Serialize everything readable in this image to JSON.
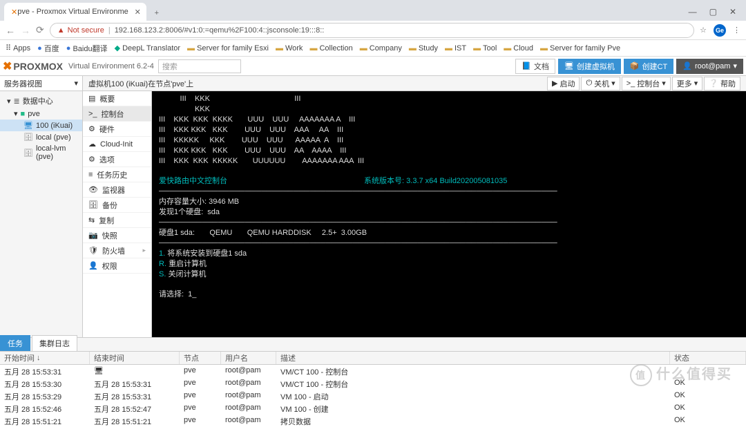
{
  "browser": {
    "tab_title": "pve - Proxmox Virtual Environme",
    "url": "192.168.123.2:8006/#v1:0:=qemu%2F100:4::jsconsole:19:::8::",
    "not_secure": "Not secure",
    "win": {
      "min": "—",
      "max": "▢",
      "close": "✕"
    },
    "avatar": "Ge"
  },
  "bookmarks": [
    "Apps",
    "百度",
    "Baidu翻译",
    "DeepL Translator",
    "Server for family Esxi",
    "Work",
    "Collection",
    "Company",
    "Study",
    "IST",
    "Tool",
    "Cloud",
    "Server for family Pve"
  ],
  "header": {
    "brand": "PROXMOX",
    "ve": "Virtual Environment 6.2-4",
    "search": "搜索",
    "doc": "文档",
    "createvm": "创建虚拟机",
    "createct": "创建CT",
    "user": "root@pam"
  },
  "sidebar": {
    "title": "服务器视图",
    "datacenter": "数据中心",
    "node": "pve",
    "vm": "100 (iKuai)",
    "storage1": "local (pve)",
    "storage2": "local-lvm (pve)"
  },
  "crumb": "虚拟机100 (iKuai)在节点'pve'上",
  "toolbar": {
    "start": "启动",
    "shutdown": "关机",
    "console": "控制台",
    "more": "更多",
    "help": "帮助"
  },
  "menu": [
    "概要",
    "控制台",
    "硬件",
    "Cloud-Init",
    "选项",
    "任务历史",
    "监视器",
    "备份",
    "复制",
    "快照",
    "防火墙",
    "权限"
  ],
  "menu_sel": 1,
  "console": {
    "ascii": "          III    KKK                                        III\n                 KKK\nIII    KKK  KKK  KKKK       UUU    UUU     AAAAAAA A    III\nIII    KKK KKK   KKK        UUU    UUU    AAA     AA    III\nIII    KKKKK     KKK        UUU    UUU      AAAAA  A    III\nIII    KKK KKK   KKK        UUU    UUU    AA    AAAA    III\nIII    KKK  KKK  KKKKK       UUUUUU        AAAAAAA AAA  III",
    "title": "爱快路由中文控制台",
    "ver_label": "系统版本号:",
    "ver": "3.3.7 x64 Build202005081035",
    "mem": "内存容量大小: 3946 MB",
    "diskfound": "发现1个硬盘:  sda",
    "divider": "──────────────────────────────────────────────────────────────────────────",
    "diskline": "硬盘1 sda:       QEMU       QEMU HARDDISK     2.5+  3.00GB",
    "opt1": "将系统安装到硬盘1 sda",
    "opt2": "重启计算机",
    "opt3": "关闭计算机",
    "prompt": "请选择:",
    "input": "1_"
  },
  "bottom": {
    "tabs": [
      "任务",
      "集群日志"
    ],
    "cols": [
      "开始时间",
      "结束时间",
      "节点",
      "用户名",
      "描述",
      "状态"
    ],
    "rows": [
      {
        "t1": "五月 28 15:53:31",
        "t2": "",
        "node": "pve",
        "user": "root@pam",
        "desc": "VM/CT 100 - 控制台",
        "st": "",
        "running": true
      },
      {
        "t1": "五月 28 15:53:30",
        "t2": "五月 28 15:53:31",
        "node": "pve",
        "user": "root@pam",
        "desc": "VM/CT 100 - 控制台",
        "st": "OK"
      },
      {
        "t1": "五月 28 15:53:29",
        "t2": "五月 28 15:53:31",
        "node": "pve",
        "user": "root@pam",
        "desc": "VM 100 - 启动",
        "st": "OK"
      },
      {
        "t1": "五月 28 15:52:46",
        "t2": "五月 28 15:52:47",
        "node": "pve",
        "user": "root@pam",
        "desc": "VM 100 - 创建",
        "st": "OK"
      },
      {
        "t1": "五月 28 15:51:21",
        "t2": "五月 28 15:51:21",
        "node": "pve",
        "user": "root@pam",
        "desc": "拷贝数据",
        "st": "OK"
      }
    ]
  },
  "watermark": "值",
  "watermark2": "什么值得买"
}
